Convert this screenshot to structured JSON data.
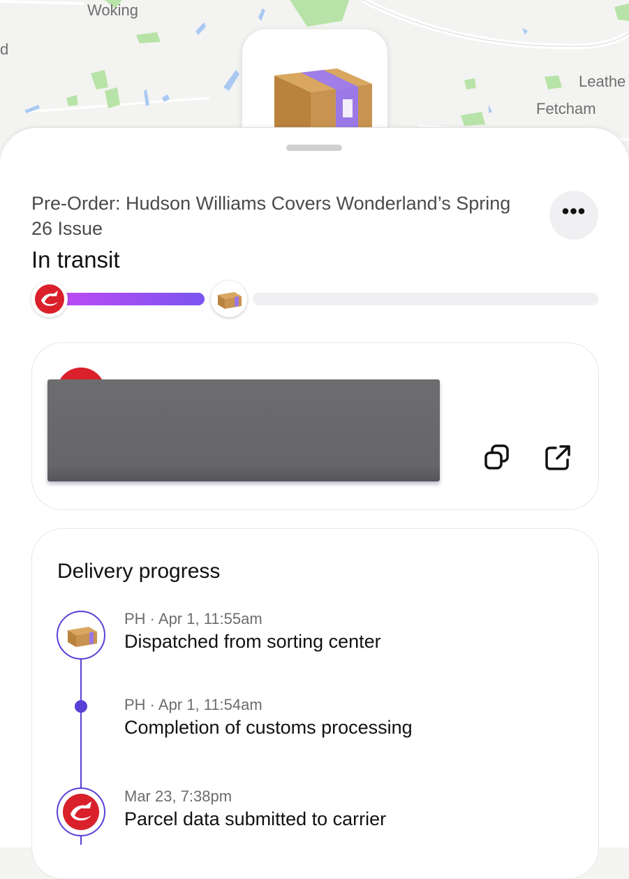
{
  "map": {
    "labels": {
      "town_1": "Woking",
      "town_2": "Leathe",
      "town_3": "Fetcham",
      "edge_1": "d"
    },
    "colors": {
      "background": "#f3f3f1",
      "water": "#a9c9f2",
      "green": "#b8e3a8",
      "road": "#ffffff"
    }
  },
  "order": {
    "title": "Pre-Order: Hudson Williams Covers Wonderland’s Spring 26 Issue",
    "more_label": "•••",
    "status": "In transit",
    "progress_fraction": 0.33
  },
  "tracking": {
    "copy_icon": "copy-icon",
    "open_icon": "external-link-icon"
  },
  "delivery": {
    "heading": "Delivery progress",
    "events": [
      {
        "meta": "PH · Apr 1, 11:55am",
        "title": "Dispatched from sorting center",
        "icon": "parcel-icon"
      },
      {
        "meta": "PH · Apr 1, 11:54am",
        "title": "Completion of customs processing",
        "icon": "dot"
      },
      {
        "meta": "Mar 23, 7:38pm",
        "title": "Parcel data submitted to carrier",
        "icon": "carrier-logo-icon"
      }
    ]
  },
  "colors": {
    "accent_purple": "#5a3fd6",
    "gradient_start": "#c649f5",
    "gradient_end": "#7a55f0",
    "carrier_red": "#d9202b"
  }
}
